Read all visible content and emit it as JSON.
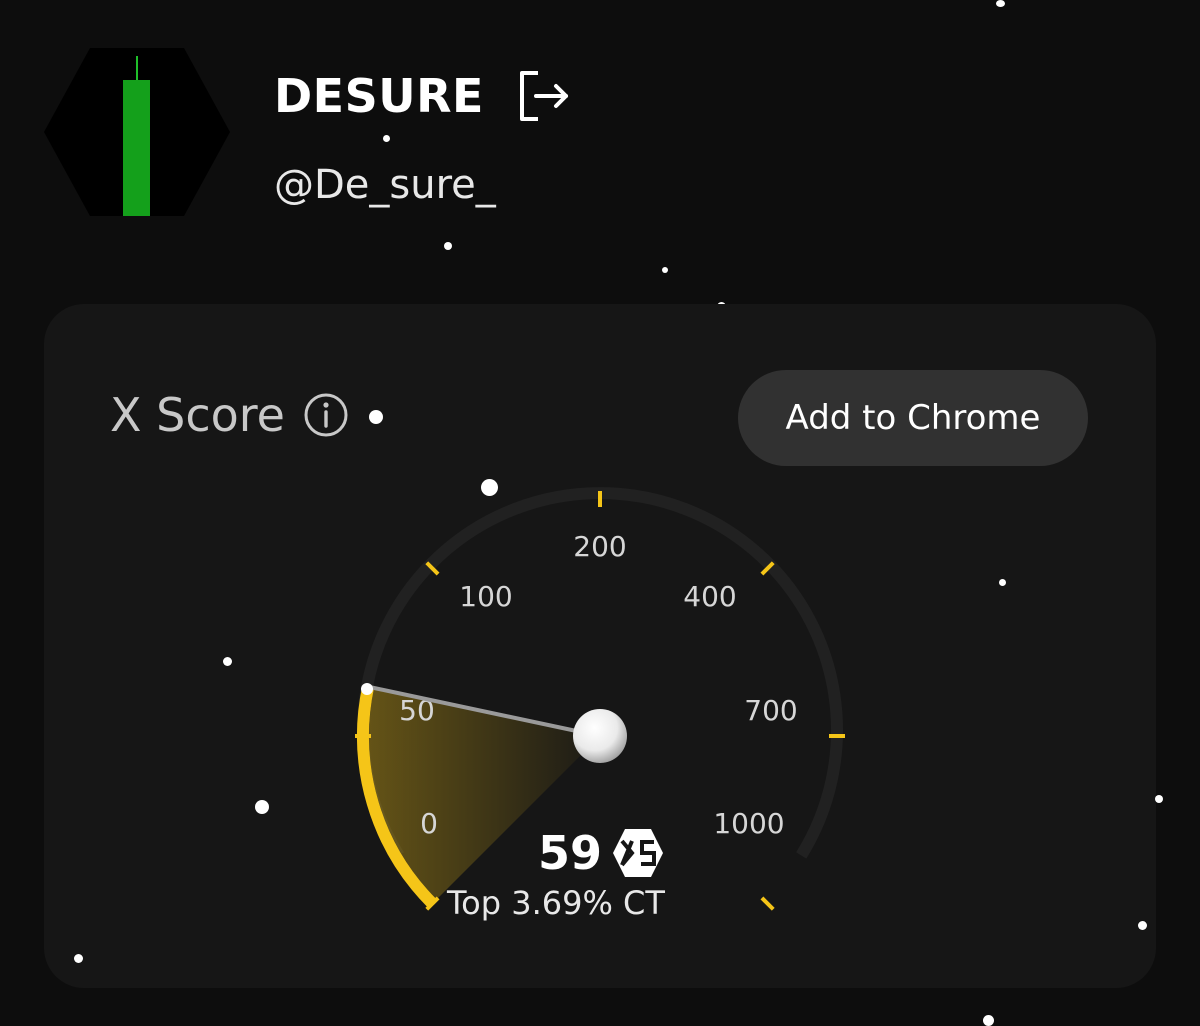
{
  "profile": {
    "name": "DESURE",
    "handle": "@De_sure_",
    "logout_icon": "logout-icon",
    "avatar_icon": "green-candlestick-hexagon-avatar"
  },
  "card": {
    "title": "X Score",
    "info_icon": "info-icon",
    "add_button_label": "Add to Chrome"
  },
  "gauge": {
    "tick_labels": [
      "0",
      "50",
      "100",
      "200",
      "400",
      "700",
      "1000"
    ],
    "score": "59",
    "score_logo": "xs-logo",
    "rank_text": "Top 3.69% CT",
    "accent_color": "#f5c518"
  }
}
